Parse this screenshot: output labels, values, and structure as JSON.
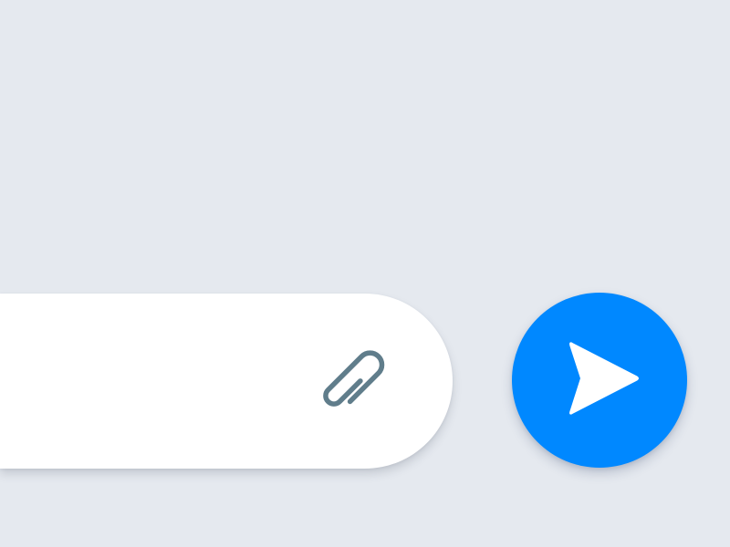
{
  "composer": {
    "message_value": "",
    "message_placeholder": ""
  },
  "icons": {
    "attach": "paperclip-icon",
    "send": "paper-plane-send-icon"
  },
  "colors": {
    "background": "#e5e9ef",
    "composer_background": "#ffffff",
    "accent": "#0088ff",
    "icon_muted": "#607d8b",
    "icon_on_accent": "#ffffff"
  }
}
